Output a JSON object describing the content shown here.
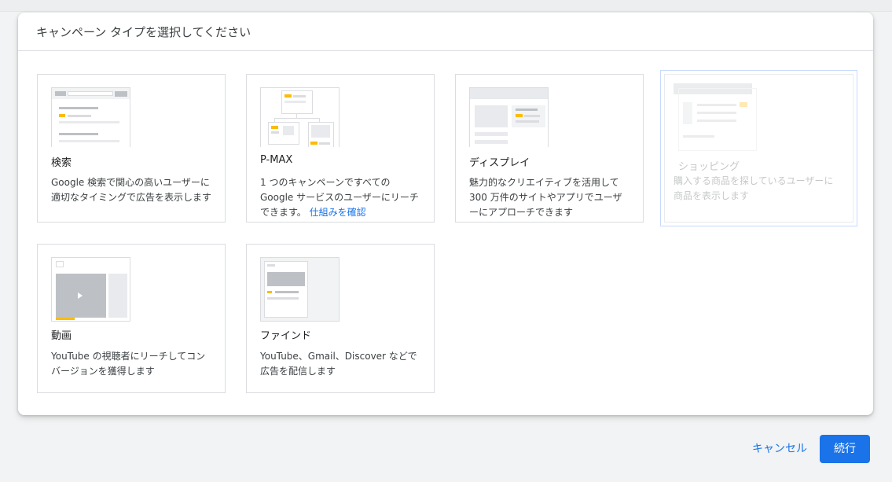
{
  "dialog": {
    "title": "キャンペーン タイプを選択してください"
  },
  "cards": [
    {
      "title": "検索",
      "description": "Google 検索で関心の高いユーザーに適切なタイミングで広告を表示します"
    },
    {
      "title": "P-MAX",
      "description": "1 つのキャンペーンですべての Google サービスのユーザーにリーチできます。",
      "link": "仕組みを確認"
    },
    {
      "title": "ディスプレイ",
      "description": "魅力的なクリエイティブを活用して 300 万件のサイトやアプリでユーザーにアプローチできます"
    },
    {
      "title": "ショッピング",
      "description": "購入する商品を探しているユーザーに商品を表示します"
    },
    {
      "title": "動画",
      "description": "YouTube の視聴者にリーチしてコンバージョンを獲得します"
    },
    {
      "title": "ファインド",
      "description": "YouTube、Gmail、Discover などで広告を配信します"
    }
  ],
  "footer": {
    "cancel_label": "キャンセル",
    "continue_label": "続行"
  },
  "colors": {
    "accent": "#1a73e8",
    "thumb_highlight": "#fbbc04",
    "thumb_gray": "#e8eaed"
  }
}
